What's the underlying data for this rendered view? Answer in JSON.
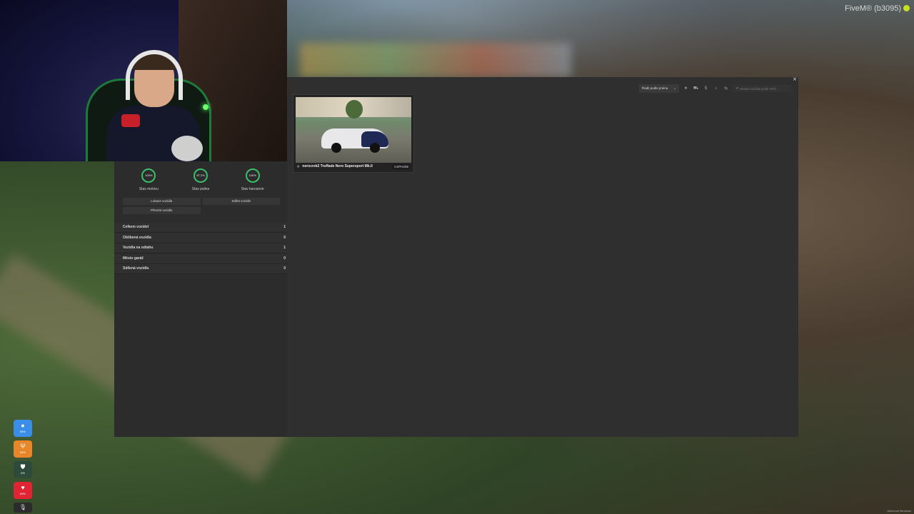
{
  "overlay": {
    "fivem_label": "FiveM® (b3095)"
  },
  "vehicle_status": {
    "gauges": [
      {
        "value": "100%",
        "label": "Stav motoru"
      },
      {
        "value": "87.2%",
        "label": "Stav paliva"
      },
      {
        "value": "100%",
        "label": "Stav karoserie"
      }
    ],
    "buttons": {
      "locate": "Lokace vozidla",
      "share": "Sdílet vozidlo",
      "transfer": "Převést vozidlo"
    },
    "stats": [
      {
        "label": "Celkem vozidel",
        "value": "1"
      },
      {
        "label": "Oblíbená vozidla",
        "value": "0"
      },
      {
        "label": "Vozidla na odtahu",
        "value": "1"
      },
      {
        "label": "Město garáž",
        "value": "0"
      },
      {
        "label": "Sdílená vozidla",
        "value": "0"
      }
    ]
  },
  "garage": {
    "close_label": "×",
    "sort_label": "Řadit podle jména",
    "sort_chevron": "⌄",
    "filter_icons": [
      "star-icon",
      "car-icon",
      "dollar-icon",
      "garage-icon",
      "tow-icon"
    ],
    "search_placeholder": "Hledat vozidla podle SPZ...",
    "vehicles": [
      {
        "name": "nerocrek2 Truffade Nero Supersport Mk.II",
        "plate": "CSPH206",
        "favorite_glyph": "★"
      }
    ]
  },
  "hud": {
    "items": [
      {
        "icon": "water-drop-icon",
        "value": "96%",
        "color": "#3b8ee8"
      },
      {
        "icon": "food-icon",
        "value": "96%",
        "color": "#e8862a"
      },
      {
        "icon": "armor-icon",
        "value": "0%",
        "color": "#2e4a3a"
      },
      {
        "icon": "heart-icon",
        "value": "69%",
        "color": "#e02434"
      }
    ],
    "mic_glyph": "🎙"
  },
  "footer_text": "Aktivovat Windows"
}
